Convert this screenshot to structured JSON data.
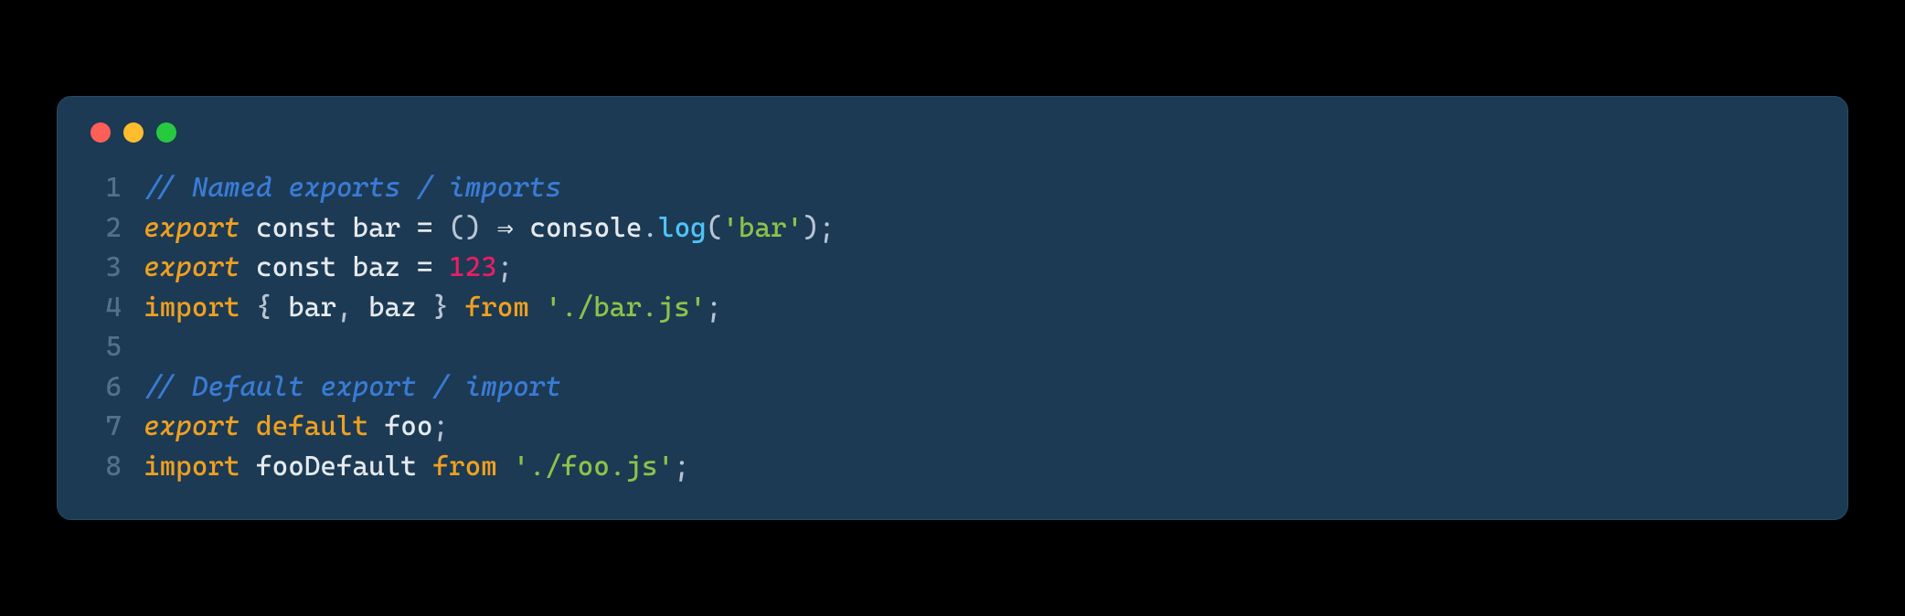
{
  "window": {
    "traffic_light_colors": {
      "red": "#ff5f56",
      "yellow": "#ffbd2e",
      "green": "#27c93f"
    }
  },
  "code": {
    "lines": [
      {
        "num": "1",
        "tokens": [
          {
            "cls": "tok-comment",
            "t": "// Named exports / imports"
          }
        ]
      },
      {
        "num": "2",
        "tokens": [
          {
            "cls": "tok-keyword",
            "t": "export"
          },
          {
            "cls": "",
            "t": " "
          },
          {
            "cls": "tok-storage",
            "t": "const"
          },
          {
            "cls": "",
            "t": " "
          },
          {
            "cls": "tok-ident",
            "t": "bar"
          },
          {
            "cls": "",
            "t": " "
          },
          {
            "cls": "tok-op",
            "t": "="
          },
          {
            "cls": "",
            "t": " "
          },
          {
            "cls": "tok-punc",
            "t": "()"
          },
          {
            "cls": "",
            "t": " "
          },
          {
            "cls": "tok-arrow",
            "t": "⇒"
          },
          {
            "cls": "",
            "t": " "
          },
          {
            "cls": "tok-obj",
            "t": "console"
          },
          {
            "cls": "tok-punc",
            "t": "."
          },
          {
            "cls": "tok-func",
            "t": "log"
          },
          {
            "cls": "tok-punc",
            "t": "("
          },
          {
            "cls": "tok-string",
            "t": "'bar'"
          },
          {
            "cls": "tok-punc",
            "t": ");"
          }
        ]
      },
      {
        "num": "3",
        "tokens": [
          {
            "cls": "tok-keyword",
            "t": "export"
          },
          {
            "cls": "",
            "t": " "
          },
          {
            "cls": "tok-storage",
            "t": "const"
          },
          {
            "cls": "",
            "t": " "
          },
          {
            "cls": "tok-ident",
            "t": "baz"
          },
          {
            "cls": "",
            "t": " "
          },
          {
            "cls": "tok-op",
            "t": "="
          },
          {
            "cls": "",
            "t": " "
          },
          {
            "cls": "tok-number",
            "t": "123"
          },
          {
            "cls": "tok-punc",
            "t": ";"
          }
        ]
      },
      {
        "num": "4",
        "tokens": [
          {
            "cls": "tok-keyword2",
            "t": "import"
          },
          {
            "cls": "",
            "t": " "
          },
          {
            "cls": "tok-punc",
            "t": "{ "
          },
          {
            "cls": "tok-ident",
            "t": "bar"
          },
          {
            "cls": "tok-punc",
            "t": ", "
          },
          {
            "cls": "tok-ident",
            "t": "baz"
          },
          {
            "cls": "tok-punc",
            "t": " }"
          },
          {
            "cls": "",
            "t": " "
          },
          {
            "cls": "tok-keyword2",
            "t": "from"
          },
          {
            "cls": "",
            "t": " "
          },
          {
            "cls": "tok-string",
            "t": "'./bar.js'"
          },
          {
            "cls": "tok-punc",
            "t": ";"
          }
        ]
      },
      {
        "num": "5",
        "tokens": [
          {
            "cls": "",
            "t": ""
          }
        ]
      },
      {
        "num": "6",
        "tokens": [
          {
            "cls": "tok-comment",
            "t": "// Default export / import"
          }
        ]
      },
      {
        "num": "7",
        "tokens": [
          {
            "cls": "tok-keyword",
            "t": "export"
          },
          {
            "cls": "",
            "t": " "
          },
          {
            "cls": "tok-keyword2",
            "t": "default"
          },
          {
            "cls": "",
            "t": " "
          },
          {
            "cls": "tok-ident",
            "t": "foo"
          },
          {
            "cls": "tok-punc",
            "t": ";"
          }
        ]
      },
      {
        "num": "8",
        "tokens": [
          {
            "cls": "tok-keyword2",
            "t": "import"
          },
          {
            "cls": "",
            "t": " "
          },
          {
            "cls": "tok-ident",
            "t": "fooDefault"
          },
          {
            "cls": "",
            "t": " "
          },
          {
            "cls": "tok-keyword2",
            "t": "from"
          },
          {
            "cls": "",
            "t": " "
          },
          {
            "cls": "tok-string",
            "t": "'./foo.js'"
          },
          {
            "cls": "tok-punc",
            "t": ";"
          }
        ]
      }
    ]
  }
}
